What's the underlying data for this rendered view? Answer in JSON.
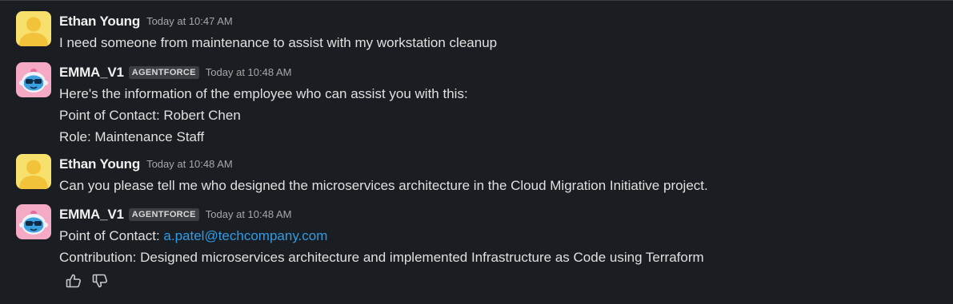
{
  "colors": {
    "background": "#1a1d21",
    "link": "#2f9ce8",
    "user_avatar_bg": "#f7e06b",
    "user_avatar_fg": "#f2c33a",
    "bot_avatar_bg": "#f4a9c5"
  },
  "messages": [
    {
      "author": "Ethan Young",
      "timestamp": "Today at 10:47 AM",
      "avatar": "user-avatar",
      "lines": [
        "I need someone from maintenance to assist with my workstation cleanup"
      ]
    },
    {
      "author": "EMMA_V1",
      "badge": "AGENTFORCE",
      "timestamp": "Today at 10:48 AM",
      "avatar": "bot-avatar",
      "lines": [
        "Here's the information of the employee who can assist you with this:",
        "Point of Contact: Robert Chen",
        "Role: Maintenance Staff"
      ]
    },
    {
      "author": "Ethan Young",
      "timestamp": "Today at 10:48 AM",
      "avatar": "user-avatar",
      "lines": [
        "Can you please tell me who designed the microservices architecture in the Cloud Migration Initiative project."
      ]
    },
    {
      "author": "EMMA_V1",
      "badge": "AGENTFORCE",
      "timestamp": "Today at 10:48 AM",
      "avatar": "bot-avatar",
      "lines": [
        "Point of Contact: ",
        "Contribution: Designed microservices architecture and implemented Infrastructure as Code using Terraform"
      ],
      "link": "a.patel@techcompany.com"
    }
  ],
  "actions": {
    "thumbs_up_icon": "thumbs-up-icon",
    "thumbs_down_icon": "thumbs-down-icon"
  }
}
